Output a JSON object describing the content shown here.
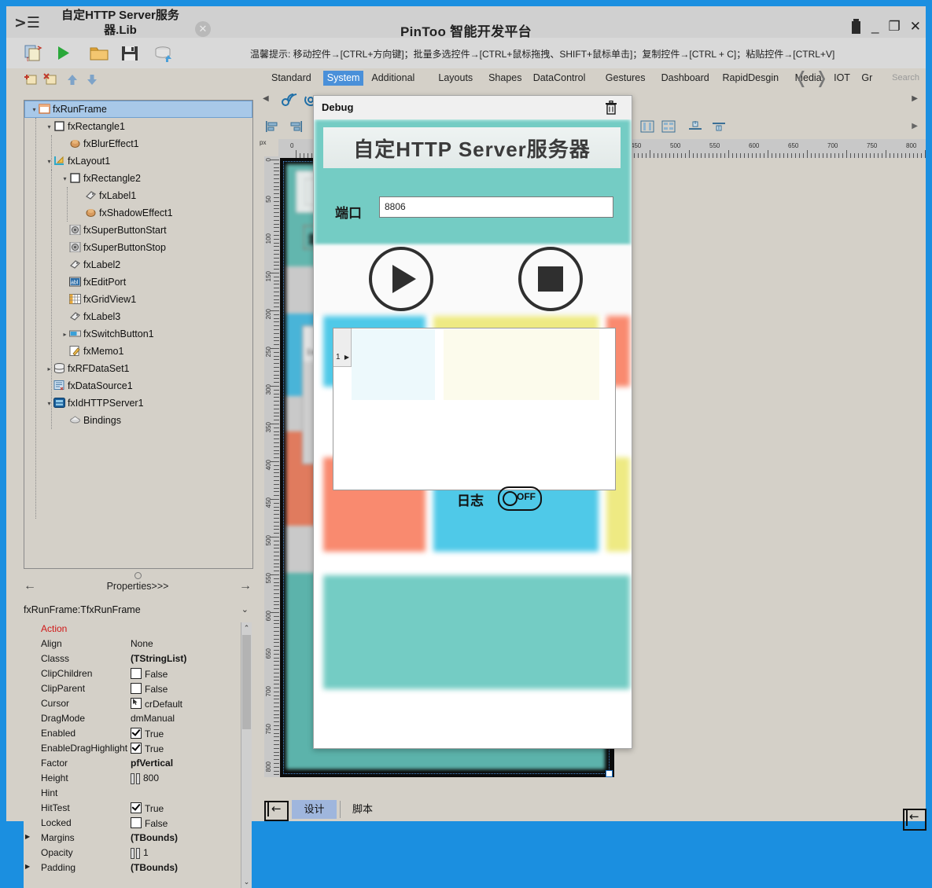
{
  "window": {
    "doc_title": "自定HTTP Server服务器.Lib",
    "app_title": "PinToo 智能开发平台",
    "doc_close": "✕",
    "minimize": "_",
    "maximize": "❐",
    "close": "✕"
  },
  "toolbar": {
    "hint": "温馨提示: 移动控件→[CTRL+方向键]；批量多选控件→[CTRL+鼠标拖拽、SHIFT+鼠标单击]；复制控件→[CTRL + C]；粘贴控件→[CTRL+V]",
    "buttons": [
      {
        "name": "new-file-icon"
      },
      {
        "name": "run-icon"
      },
      {
        "name": "open-folder-icon"
      },
      {
        "name": "save-icon"
      },
      {
        "name": "database-upload-icon"
      }
    ]
  },
  "tree_toolbar": [
    {
      "name": "add-node-icon"
    },
    {
      "name": "delete-node-icon"
    },
    {
      "name": "move-up-icon"
    },
    {
      "name": "move-down-icon"
    }
  ],
  "tree": {
    "nodes": [
      {
        "label": "fxRunFrame",
        "depth": 0,
        "expander": "▾",
        "icon": "frame-icon",
        "selected": true
      },
      {
        "label": "fxRectangle1",
        "depth": 1,
        "expander": "▾",
        "icon": "rectangle-icon",
        "selected": false
      },
      {
        "label": "fxBlurEffect1",
        "depth": 2,
        "expander": "",
        "icon": "effect-icon",
        "selected": false
      },
      {
        "label": "fxLayout1",
        "depth": 1,
        "expander": "▾",
        "icon": "layout-icon",
        "selected": false
      },
      {
        "label": "fxRectangle2",
        "depth": 2,
        "expander": "▾",
        "icon": "rectangle-icon",
        "selected": false
      },
      {
        "label": "fxLabel1",
        "depth": 3,
        "expander": "",
        "icon": "label-icon",
        "selected": false
      },
      {
        "label": "fxShadowEffect1",
        "depth": 3,
        "expander": "",
        "icon": "effect-icon",
        "selected": false
      },
      {
        "label": "fxSuperButtonStart",
        "depth": 2,
        "expander": "",
        "icon": "button-icon",
        "selected": false
      },
      {
        "label": "fxSuperButtonStop",
        "depth": 2,
        "expander": "",
        "icon": "button-icon",
        "selected": false
      },
      {
        "label": "fxLabel2",
        "depth": 2,
        "expander": "",
        "icon": "label-icon",
        "selected": false
      },
      {
        "label": "fxEditPort",
        "depth": 2,
        "expander": "",
        "icon": "edit-icon",
        "selected": false
      },
      {
        "label": "fxGridView1",
        "depth": 2,
        "expander": "",
        "icon": "gridview-icon",
        "selected": false
      },
      {
        "label": "fxLabel3",
        "depth": 2,
        "expander": "",
        "icon": "label-icon",
        "selected": false
      },
      {
        "label": "fxSwitchButton1",
        "depth": 2,
        "expander": "▸",
        "icon": "switch-icon",
        "selected": false
      },
      {
        "label": "fxMemo1",
        "depth": 2,
        "expander": "",
        "icon": "memo-icon",
        "selected": false
      },
      {
        "label": "fxRFDataSet1",
        "depth": 1,
        "expander": "▸",
        "icon": "dataset-icon",
        "selected": false
      },
      {
        "label": "fxDataSource1",
        "depth": 1,
        "expander": "",
        "icon": "datasource-icon",
        "selected": false
      },
      {
        "label": "fxIdHTTPServer1",
        "depth": 1,
        "expander": "▾",
        "icon": "server-icon",
        "selected": false
      },
      {
        "label": "Bindings",
        "depth": 2,
        "expander": "",
        "icon": "bindings-icon",
        "selected": false
      }
    ]
  },
  "properties": {
    "header": "Properties>>>",
    "prev_arrow": "←",
    "next_arrow": "→",
    "selected_object": "fxRunFrame:TfxRunFrame",
    "dropdown_caret": "⌄",
    "rows": [
      {
        "name": "Action",
        "value": "",
        "kind": "header",
        "expander": false
      },
      {
        "name": "Align",
        "value": "None",
        "kind": "text",
        "expander": false
      },
      {
        "name": "Classs",
        "value": "(TStringList)",
        "kind": "bold",
        "expander": false
      },
      {
        "name": "ClipChildren",
        "value": "False",
        "kind": "checkbox-off",
        "expander": false
      },
      {
        "name": "ClipParent",
        "value": "False",
        "kind": "checkbox-off",
        "expander": false
      },
      {
        "name": "Cursor",
        "value": "crDefault",
        "kind": "cursor",
        "expander": false
      },
      {
        "name": "DragMode",
        "value": "dmManual",
        "kind": "text",
        "expander": false
      },
      {
        "name": "Enabled",
        "value": "True",
        "kind": "checkbox-on",
        "expander": false
      },
      {
        "name": "EnableDragHighlight",
        "value": "True",
        "kind": "checkbox-on",
        "expander": false
      },
      {
        "name": "Factor",
        "value": "pfVertical",
        "kind": "bold",
        "expander": false
      },
      {
        "name": "Height",
        "value": "800",
        "kind": "numeric",
        "expander": false
      },
      {
        "name": "Hint",
        "value": "",
        "kind": "text",
        "expander": false
      },
      {
        "name": "HitTest",
        "value": "True",
        "kind": "checkbox-on",
        "expander": false
      },
      {
        "name": "Locked",
        "value": "False",
        "kind": "checkbox-off",
        "expander": false
      },
      {
        "name": "Margins",
        "value": "(TBounds)",
        "kind": "bold",
        "expander": true
      },
      {
        "name": "Opacity",
        "value": "1",
        "kind": "numeric",
        "expander": false
      },
      {
        "name": "Padding",
        "value": "(TBounds)",
        "kind": "bold",
        "expander": true
      }
    ]
  },
  "palette": {
    "tabs": [
      {
        "label": "Standard",
        "active": false
      },
      {
        "label": "System",
        "active": true
      },
      {
        "label": "Additional",
        "active": false
      },
      {
        "label": "Layouts",
        "active": false
      },
      {
        "label": "Shapes",
        "active": false
      },
      {
        "label": "DataControl",
        "active": false
      },
      {
        "label": "Gestures",
        "active": false
      },
      {
        "label": "Dashboard",
        "active": false
      },
      {
        "label": "RapidDesgin",
        "active": false
      },
      {
        "label": "Media",
        "active": false
      },
      {
        "label": "IOT",
        "active": false
      },
      {
        "label": "Gr",
        "active": false
      }
    ],
    "prev_arrow": "❬",
    "next_arrow": "❭",
    "search_placeholder": "Search",
    "scroll_left": "◀",
    "scroll_right": "▶"
  },
  "rulers": {
    "unit": "px",
    "h_ticks": [
      "0",
      "450",
      "500",
      "550",
      "600",
      "650",
      "700",
      "750",
      "800"
    ],
    "v_ticks": [
      "0",
      "50",
      "100",
      "150",
      "200",
      "250",
      "300",
      "350",
      "400",
      "450",
      "500",
      "550",
      "600",
      "650",
      "700",
      "750",
      "800"
    ]
  },
  "bottom": {
    "back_icon": "←",
    "tab_design": "设计",
    "tab_script": "脚本",
    "collapse_icon": "←"
  },
  "debug_window": {
    "title": "Debug",
    "trash_icon": "trash-icon",
    "form": {
      "heading": "自定HTTP Server服务器",
      "port_label": "端口",
      "port_value": "8806",
      "start_button": "start-button",
      "stop_button": "stop-button",
      "grid_row_number": "1",
      "grid_row_arrow": "▶",
      "log_label": "日志",
      "log_switch_state": "OFF"
    }
  },
  "colors": {
    "accent": "#1b8fe0",
    "tab_active": "#4a90d9",
    "teal": "#74ccc4",
    "cyan": "#4fc9e8",
    "yellow": "#eeea83",
    "salmon": "#f98a6f",
    "tree_selection": "#a8c8e8",
    "panel_bg": "#d4d0c8"
  }
}
